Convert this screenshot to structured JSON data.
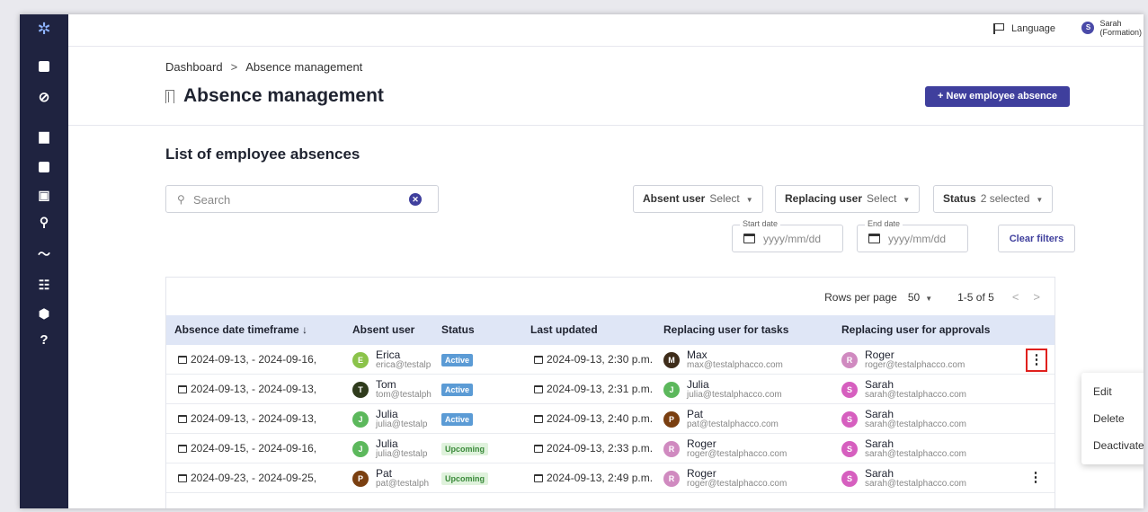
{
  "topbar": {
    "language_label": "Language",
    "user_initial": "S",
    "user_name": "Sarah",
    "user_role": "(Formation)"
  },
  "breadcrumb": {
    "root": "Dashboard",
    "separator": ">",
    "current": "Absence management"
  },
  "page": {
    "title": "Absence management",
    "new_button": "+ New employee absence"
  },
  "list": {
    "title": "List of employee absences"
  },
  "search": {
    "placeholder": "Search"
  },
  "filters": {
    "absent_user": {
      "label": "Absent user",
      "value": "Select"
    },
    "replacing_user": {
      "label": "Replacing user",
      "value": "Select"
    },
    "status": {
      "label": "Status",
      "value": "2 selected"
    },
    "start_date": {
      "label": "Start date",
      "placeholder": "yyyy/mm/dd"
    },
    "end_date": {
      "label": "End date",
      "placeholder": "yyyy/mm/dd"
    },
    "clear_button": "Clear filters"
  },
  "pagination": {
    "rows_label": "Rows per page",
    "rows_value": "50",
    "range": "1-5 of 5"
  },
  "columns": {
    "timeframe": "Absence date timeframe ↓",
    "absent_user": "Absent user",
    "status": "Status",
    "last_updated": "Last updated",
    "replacing_tasks": "Replacing user for tasks",
    "replacing_approvals": "Replacing user for approvals"
  },
  "rows": [
    {
      "timeframe": "2024-09-13, - 2024-09-16,",
      "absent": {
        "initial": "E",
        "name": "Erica",
        "email": "erica@testalp",
        "color": "#8bc34a"
      },
      "status": "Active",
      "updated": "2024-09-13, 2:30 p.m.",
      "tasks": {
        "initial": "M",
        "name": "Max",
        "email": "max@testalphacco.com",
        "color": "#3e2c1a"
      },
      "approvals": {
        "initial": "R",
        "name": "Roger",
        "email": "roger@testalphacco.com",
        "color": "#d08ac0"
      }
    },
    {
      "timeframe": "2024-09-13, - 2024-09-13,",
      "absent": {
        "initial": "T",
        "name": "Tom",
        "email": "tom@testalph",
        "color": "#2f3b1c"
      },
      "status": "Active",
      "updated": "2024-09-13, 2:31 p.m.",
      "tasks": {
        "initial": "J",
        "name": "Julia",
        "email": "julia@testalphacco.com",
        "color": "#5cb85c"
      },
      "approvals": {
        "initial": "S",
        "name": "Sarah",
        "email": "sarah@testalphacco.com",
        "color": "#d65fbf"
      }
    },
    {
      "timeframe": "2024-09-13, - 2024-09-13,",
      "absent": {
        "initial": "J",
        "name": "Julia",
        "email": "julia@testalp",
        "color": "#5cb85c"
      },
      "status": "Active",
      "updated": "2024-09-13, 2:40 p.m.",
      "tasks": {
        "initial": "P",
        "name": "Pat",
        "email": "pat@testalphacco.com",
        "color": "#7a3f10"
      },
      "approvals": {
        "initial": "S",
        "name": "Sarah",
        "email": "sarah@testalphacco.com",
        "color": "#d65fbf"
      }
    },
    {
      "timeframe": "2024-09-15, - 2024-09-16,",
      "absent": {
        "initial": "J",
        "name": "Julia",
        "email": "julia@testalp",
        "color": "#5cb85c"
      },
      "status": "Upcoming",
      "updated": "2024-09-13, 2:33 p.m.",
      "tasks": {
        "initial": "R",
        "name": "Roger",
        "email": "roger@testalphacco.com",
        "color": "#d08ac0"
      },
      "approvals": {
        "initial": "S",
        "name": "Sarah",
        "email": "sarah@testalphacco.com",
        "color": "#d65fbf"
      }
    },
    {
      "timeframe": "2024-09-23, - 2024-09-25,",
      "absent": {
        "initial": "P",
        "name": "Pat",
        "email": "pat@testalph",
        "color": "#7a3f10"
      },
      "status": "Upcoming",
      "updated": "2024-09-13, 2:49 p.m.",
      "tasks": {
        "initial": "R",
        "name": "Roger",
        "email": "roger@testalphacco.com",
        "color": "#d08ac0"
      },
      "approvals": {
        "initial": "S",
        "name": "Sarah",
        "email": "sarah@testalphacco.com",
        "color": "#d65fbf"
      }
    }
  ],
  "status_colors": {
    "Active": {
      "bg": "#5b9bd5",
      "fg": "#ffffff"
    },
    "Upcoming": {
      "bg": "#dff2dc",
      "fg": "#3a8a3a"
    }
  },
  "context_menu": {
    "items": [
      "Edit",
      "Delete",
      "Deactivate"
    ]
  },
  "icons": {
    "sidebar": [
      "logo-icon",
      "dashboard-chart-icon",
      "check-circle-icon",
      "messages-icon",
      "reports-chart-icon",
      "library-icon",
      "search-icon",
      "trend-icon",
      "sliders-icon",
      "shield-icon",
      "help-icon"
    ],
    "kebab": "more-vertical-icon"
  }
}
